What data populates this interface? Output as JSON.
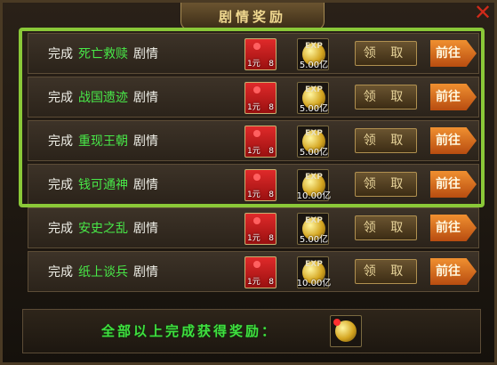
{
  "title": "剧情奖励",
  "rows": [
    {
      "prefix": "完成",
      "name": "死亡救赎",
      "suffix": "剧情",
      "reward1_label": "1元",
      "reward1_count": "8",
      "exp_label": "EXP",
      "exp_amount": "5.00亿",
      "claim": "领 取",
      "go": "前往"
    },
    {
      "prefix": "完成",
      "name": "战国遗迹",
      "suffix": "剧情",
      "reward1_label": "1元",
      "reward1_count": "8",
      "exp_label": "EXP",
      "exp_amount": "5.00亿",
      "claim": "领 取",
      "go": "前往"
    },
    {
      "prefix": "完成",
      "name": "重现王朝",
      "suffix": "剧情",
      "reward1_label": "1元",
      "reward1_count": "8",
      "exp_label": "EXP",
      "exp_amount": "5.00亿",
      "claim": "领 取",
      "go": "前往"
    },
    {
      "prefix": "完成",
      "name": "钱可通神",
      "suffix": "剧情",
      "reward1_label": "1元",
      "reward1_count": "8",
      "exp_label": "EXP",
      "exp_amount": "10.00亿",
      "claim": "领 取",
      "go": "前往"
    },
    {
      "prefix": "完成",
      "name": "安史之乱",
      "suffix": "剧情",
      "reward1_label": "1元",
      "reward1_count": "8",
      "exp_label": "EXP",
      "exp_amount": "5.00亿",
      "claim": "领 取",
      "go": "前往"
    },
    {
      "prefix": "完成",
      "name": "纸上谈兵",
      "suffix": "剧情",
      "reward1_label": "1元",
      "reward1_count": "8",
      "exp_label": "EXP",
      "exp_amount": "10.00亿",
      "claim": "领 取",
      "go": "前往"
    }
  ],
  "footer": {
    "text": "全部以上完成获得奖励："
  },
  "colors": {
    "highlight": "#8ac838",
    "quest_name": "#48e848",
    "footer_text": "#3fe03f"
  }
}
